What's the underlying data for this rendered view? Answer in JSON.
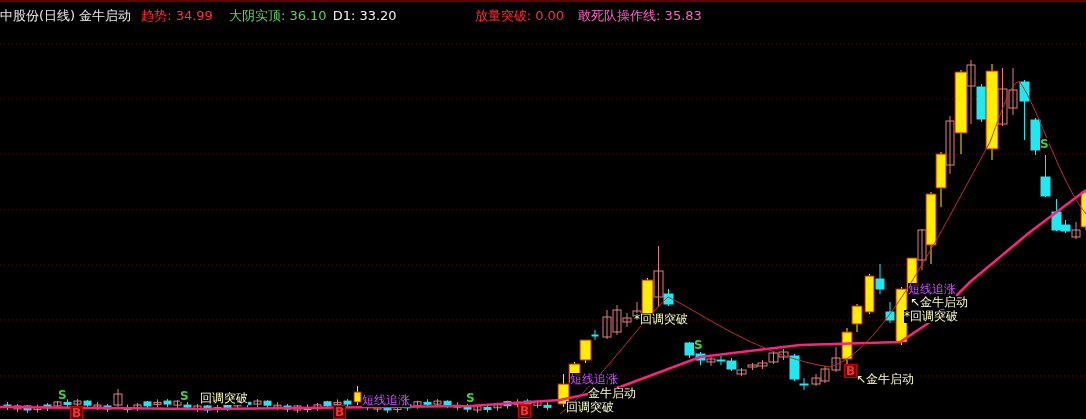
{
  "header": {
    "title": "中股份(日线)",
    "formula": "金牛启动",
    "indicators": [
      {
        "text": "趋势: 34.99",
        "color": "#ff3030"
      },
      {
        "text": "大阴实顶: 36.10",
        "color": "#60d060"
      },
      {
        "text": "D1: 33.20",
        "color": "#f0f0f0"
      },
      {
        "text": "放量突破: 0.00",
        "color": "#ff3030"
      },
      {
        "text": "敢死队操作线: 35.83",
        "color": "#ff60c0"
      }
    ]
  },
  "chart": {
    "annotations": [
      {
        "kind": "note",
        "text": "回调突破"
      },
      {
        "kind": "chase",
        "text": "短线追涨"
      },
      {
        "kind": "chase",
        "text": "短线追涨"
      },
      {
        "kind": "note",
        "text": "金牛启动"
      },
      {
        "kind": "note",
        "text": "回调突破"
      },
      {
        "kind": "note",
        "text": "*回调突破"
      },
      {
        "kind": "note",
        "text": "↖金牛启动"
      },
      {
        "kind": "chase",
        "text": "短线追涨"
      },
      {
        "kind": "note",
        "text": "↖金牛启动"
      },
      {
        "kind": "note",
        "text": "*回调突破"
      }
    ],
    "markers": [
      {
        "kind": "sell",
        "text": "S"
      },
      {
        "kind": "buy",
        "text": "B"
      },
      {
        "kind": "sell",
        "text": "S"
      },
      {
        "kind": "buy",
        "text": "B"
      },
      {
        "kind": "sell",
        "text": "S"
      },
      {
        "kind": "buy",
        "text": "B"
      },
      {
        "kind": "sell",
        "text": "S"
      },
      {
        "kind": "buy",
        "text": "B"
      },
      {
        "kind": "sell",
        "text": "S"
      }
    ]
  }
}
